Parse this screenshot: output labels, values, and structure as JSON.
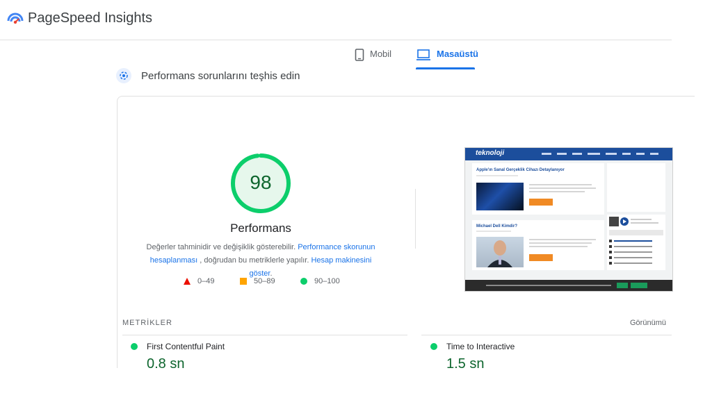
{
  "app": {
    "title": "PageSpeed Insights"
  },
  "tabs": [
    {
      "label": "Mobil",
      "icon": "phone-icon",
      "active": false
    },
    {
      "label": "Masaüstü",
      "icon": "laptop-icon",
      "active": true
    }
  ],
  "section": {
    "title": "Performans sorunlarını teşhis edin",
    "icon": "diagnostic-icon"
  },
  "score": {
    "value": "98",
    "label": "Performans",
    "color": "#0cce6b",
    "fraction": 0.98
  },
  "description": {
    "text1": "Değerler tahminidir ve değişiklik gösterebilir. ",
    "link1": "Performance skorunun hesaplanması",
    "text2": " , doğrudan bu metriklerle yapılır. ",
    "link2": "Hesap makinesini göster",
    "text3": "."
  },
  "legend": [
    {
      "range": "0–49",
      "shape": "triangle",
      "color": "#eb0f00"
    },
    {
      "range": "50–89",
      "shape": "square",
      "color": "#ffa400"
    },
    {
      "range": "90–100",
      "shape": "circle",
      "color": "#0cce6b"
    }
  ],
  "screenshot": {
    "logo_text": "teknoloji",
    "article1_title": "Apple'ın Sanal Gerçeklik Cihazı Detaylanıyor",
    "article2_title": "Michael Dell Kimdir?"
  },
  "metrics": {
    "header": "METRİKLER",
    "view_label": "Görünümü",
    "items": [
      {
        "name": "First Contentful Paint",
        "value": "0,8 sn",
        "status_color": "#0cce6b"
      },
      {
        "name": "Time to Interactive",
        "value": "1,5 sn",
        "status_color": "#0cce6b"
      }
    ]
  }
}
